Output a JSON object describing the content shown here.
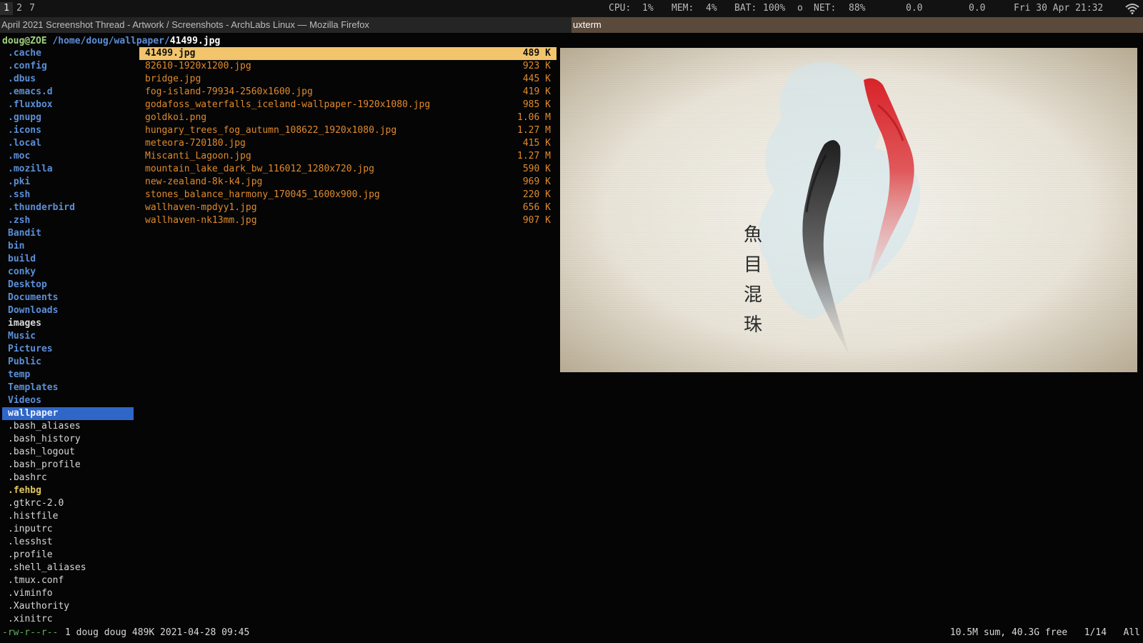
{
  "topbar": {
    "workspaces": [
      "1",
      "2",
      "7"
    ],
    "active_workspace": "1",
    "cpu_label": "CPU:",
    "cpu_value": "1%",
    "mem_label": "MEM:",
    "mem_value": "4%",
    "bat_label": "BAT:",
    "bat_value": "100%",
    "bat_icon": "o",
    "net_label": "NET:",
    "net_value": "88%",
    "net_down": "0.0",
    "net_up": "0.0",
    "clock": "Fri 30 Apr 21:32",
    "wifi_icon": "wifi-icon"
  },
  "windows": {
    "left_title": "April 2021 Screenshot Thread - Artwork / Screenshots - ArchLabs Linux — Mozilla Firefox",
    "right_title": "uxterm"
  },
  "ranger": {
    "header": {
      "user_host": "doug@ZOE",
      "path": "/home/doug/wallpaper/",
      "file": "41499.jpg"
    },
    "parent_items": [
      {
        "name": ".cache",
        "kind": "dir"
      },
      {
        "name": ".config",
        "kind": "dir"
      },
      {
        "name": ".dbus",
        "kind": "dir"
      },
      {
        "name": ".emacs.d",
        "kind": "dir"
      },
      {
        "name": ".fluxbox",
        "kind": "dir"
      },
      {
        "name": ".gnupg",
        "kind": "dir"
      },
      {
        "name": ".icons",
        "kind": "dir"
      },
      {
        "name": ".local",
        "kind": "dir"
      },
      {
        "name": ".moc",
        "kind": "dir"
      },
      {
        "name": ".mozilla",
        "kind": "dir"
      },
      {
        "name": ".pki",
        "kind": "dir"
      },
      {
        "name": ".ssh",
        "kind": "dir"
      },
      {
        "name": ".thunderbird",
        "kind": "dir"
      },
      {
        "name": ".zsh",
        "kind": "dir"
      },
      {
        "name": "Bandit",
        "kind": "dir"
      },
      {
        "name": "bin",
        "kind": "dir"
      },
      {
        "name": "build",
        "kind": "dir"
      },
      {
        "name": "conky",
        "kind": "dir"
      },
      {
        "name": "Desktop",
        "kind": "dir"
      },
      {
        "name": "Documents",
        "kind": "dir"
      },
      {
        "name": "Downloads",
        "kind": "dir"
      },
      {
        "name": "images",
        "kind": "dirw"
      },
      {
        "name": "Music",
        "kind": "dir"
      },
      {
        "name": "Pictures",
        "kind": "dir"
      },
      {
        "name": "Public",
        "kind": "dir"
      },
      {
        "name": "temp",
        "kind": "dir"
      },
      {
        "name": "Templates",
        "kind": "dir"
      },
      {
        "name": "Videos",
        "kind": "dir"
      },
      {
        "name": "wallpaper",
        "kind": "selected"
      },
      {
        "name": ".bash_aliases",
        "kind": "file"
      },
      {
        "name": ".bash_history",
        "kind": "file"
      },
      {
        "name": ".bash_logout",
        "kind": "file"
      },
      {
        "name": ".bash_profile",
        "kind": "file"
      },
      {
        "name": ".bashrc",
        "kind": "file"
      },
      {
        "name": ".fehbg",
        "kind": "exec"
      },
      {
        "name": ".gtkrc-2.0",
        "kind": "file"
      },
      {
        "name": ".histfile",
        "kind": "file"
      },
      {
        "name": ".inputrc",
        "kind": "file"
      },
      {
        "name": ".lesshst",
        "kind": "file"
      },
      {
        "name": ".profile",
        "kind": "file"
      },
      {
        "name": ".shell_aliases",
        "kind": "file"
      },
      {
        "name": ".tmux.conf",
        "kind": "file"
      },
      {
        "name": ".viminfo",
        "kind": "file"
      },
      {
        "name": ".Xauthority",
        "kind": "file"
      },
      {
        "name": ".xinitrc",
        "kind": "file"
      }
    ],
    "files": [
      {
        "name": "41499.jpg",
        "size": "489 K",
        "selected": true
      },
      {
        "name": "82610-1920x1200.jpg",
        "size": "923 K"
      },
      {
        "name": "bridge.jpg",
        "size": "445 K"
      },
      {
        "name": "fog-island-79934-2560x1600.jpg",
        "size": "419 K"
      },
      {
        "name": "godafoss_waterfalls_iceland-wallpaper-1920x1080.jpg",
        "size": "985 K"
      },
      {
        "name": "goldkoi.png",
        "size": "1.06 M"
      },
      {
        "name": "hungary_trees_fog_autumn_108622_1920x1080.jpg",
        "size": "1.27 M"
      },
      {
        "name": "meteora-720180.jpg",
        "size": "415 K"
      },
      {
        "name": "Miscanti_Lagoon.jpg",
        "size": "1.27 M"
      },
      {
        "name": "mountain_lake_dark_bw_116012_1280x720.jpg",
        "size": "590 K"
      },
      {
        "name": "new-zealand-8k-k4.jpg",
        "size": "969 K"
      },
      {
        "name": "stones_balance_harmony_170045_1600x900.jpg",
        "size": "220 K"
      },
      {
        "name": "wallhaven-mpdyy1.jpg",
        "size": "656 K"
      },
      {
        "name": "wallhaven-nk13mm.jpg",
        "size": "907 K"
      }
    ],
    "preview": {
      "calligraphy": [
        "魚",
        "目",
        "混",
        "珠"
      ],
      "colors": {
        "koi_red": "#d8232a",
        "koi_black": "#2a2a2a",
        "ink_blue": "#cfe6ee",
        "paper": "#ece7dc"
      }
    },
    "status": {
      "permissions": "-rw-r--r--",
      "info": "1 doug doug 489K 2021-04-28 09:45",
      "summary": "10.5M sum, 40.3G free",
      "position": "1/14",
      "scroll": "All"
    }
  }
}
